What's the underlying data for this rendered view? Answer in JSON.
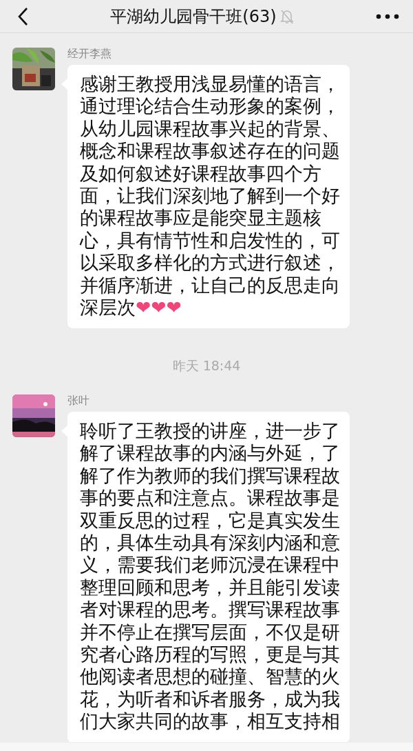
{
  "header": {
    "title": "平湖幼儿园骨干班(63)",
    "muted": true
  },
  "messages": [
    {
      "kind": "message",
      "sender": "经开李燕",
      "text": "感谢王教授用浅显易懂的语言，通过理论结合生动形象的案例，从幼儿园课程故事兴起的背景、概念和课程故事叙述存在的问题及如何叙述好课程故事四个方面，让我们深刻地了解到一个好的课程故事应是能突显主题核心，具有情节性和启发性的，可以采取多样化的方式进行叙述，并循序渐进，让自己的反思走向深层次",
      "emoji": "❤❤❤"
    },
    {
      "kind": "time",
      "text": "昨天 18:44"
    },
    {
      "kind": "message",
      "sender": "张叶",
      "text": "聆听了王教授的讲座，进一步了解了课程故事的内涵与外延，了解了作为教师的我们撰写课程故事的要点和注意点。课程故事是双重反思的过程，它是真实发生的，具体生动具有深刻内涵和意义，需要我们老师沉浸在课程中整理回顾和思考，并且能引发读者对课程的思考。撰写课程故事并不停止在撰写层面，不仅是研究者心路历程的写照，更是与其他阅读者思想的碰撞、智慧的火花，为听者和诉者服务，成为我们大家共同的故事，相互支持相"
    }
  ]
}
